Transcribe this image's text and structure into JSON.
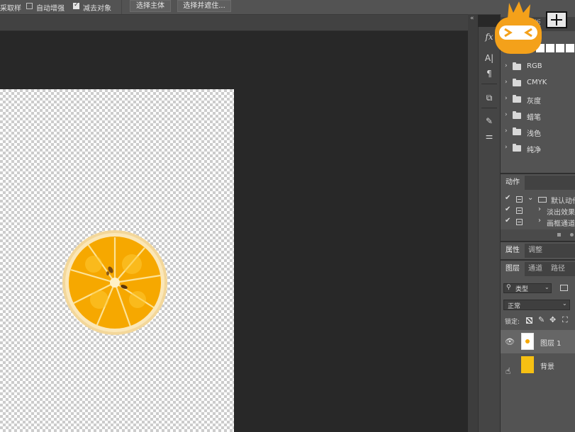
{
  "options_bar": {
    "sample_label": "采取样",
    "auto_enhance_label": "自动增强",
    "auto_enhance_checked": false,
    "subtract_label": "减去对象",
    "subtract_checked": true,
    "select_subject_button": "选择主体",
    "select_and_mask_button": "选择并遮住..."
  },
  "tools": {
    "fx": "fx",
    "char": "A|",
    "para": "¶",
    "clone": "⧉",
    "brush": "✎",
    "sliders": "⚌"
  },
  "swatch_panel": {
    "tab_label_1": "板",
    "tab_label_2": "用",
    "folders": [
      {
        "label": "RGB"
      },
      {
        "label": "CMYK"
      },
      {
        "label": "灰度"
      },
      {
        "label": "蜡笔"
      },
      {
        "label": "浅色"
      },
      {
        "label": "纯净"
      }
    ]
  },
  "actions_panel": {
    "tab": "动作",
    "rows": [
      {
        "check": "✔",
        "label": "默认动作",
        "chev": "⌄"
      },
      {
        "check": "✔",
        "label": "淡出效果",
        "chev": "›"
      },
      {
        "check": "✔",
        "label": "画框通道",
        "chev": "›"
      }
    ]
  },
  "properties_tabs": [
    "属性",
    "调整"
  ],
  "layers_tabs": [
    "图层",
    "通道",
    "路径"
  ],
  "layers_panel": {
    "filter_label": "类型",
    "blend_mode": "正常",
    "lock_label": "锁定:",
    "layers": [
      {
        "name": "图层 1",
        "visible": true,
        "selected": true
      },
      {
        "name": "背景",
        "visible": false,
        "selected": false
      }
    ]
  },
  "colors": {
    "orange": "#f6a800",
    "panel_bg": "#535353",
    "canvas_bg": "#282828"
  }
}
